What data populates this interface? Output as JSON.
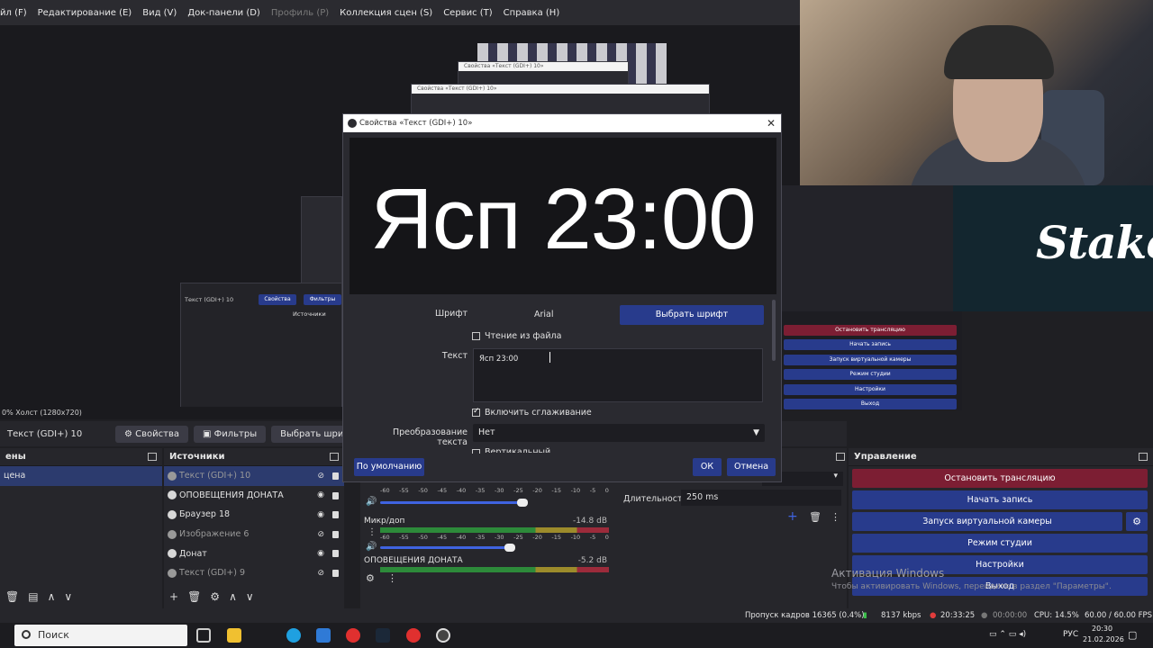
{
  "menu": {
    "items": [
      "йл (F)",
      "Редактирование (E)",
      "Вид (V)",
      "Док-панели (D)",
      "Профиль (P)",
      "Коллекция сцен (S)",
      "Сервис (T)",
      "Справка (H)"
    ]
  },
  "nested": {
    "title_small": "Свойства «Текст (GDI+) 10»",
    "canvas_small": "Холст (1280x720)",
    "source_small": "Текст (GDI+) 10",
    "props_small": "Свойства",
    "filters_small": "Фильтры",
    "sources_small": "Источники"
  },
  "overlay": {
    "stake": "Stake"
  },
  "controls_bg": {
    "stop": "Остановить трансляцию",
    "record": "Начать запись",
    "vcam": "Запуск виртуальной камеры",
    "studio": "Режим студии",
    "settings": "Настройки",
    "exit": "Выход"
  },
  "canvas_bar": "0%   Холст (1280x720)",
  "toolbar": {
    "source_name": "Текст (GDI+) 10",
    "properties": "Свойства",
    "filters": "Фильтры",
    "choose_font": "Выбрать шрифт"
  },
  "scenes": {
    "title": "ены",
    "items": [
      {
        "label": "цена"
      }
    ]
  },
  "sources": {
    "title": "Источники",
    "items": [
      {
        "label": "Текст (GDI+) 10"
      },
      {
        "label": "ОПОВЕЩЕНИЯ ДОНАТА"
      },
      {
        "label": "Браузер 18"
      },
      {
        "label": "Изображение 6"
      },
      {
        "label": "Донат"
      },
      {
        "label": "Текст (GDI+) 9"
      }
    ]
  },
  "mixer": {
    "scale": [
      "-60",
      "-55",
      "-50",
      "-45",
      "-40",
      "-35",
      "-30",
      "-25",
      "-20",
      "-15",
      "-10",
      "-5",
      "0"
    ],
    "channels": [
      {
        "name": "",
        "level": ""
      },
      {
        "name": "Микр/доп",
        "level": "-14.8 dB"
      },
      {
        "name": "ОПОВЕЩЕНИЯ ДОНАТА",
        "level": "-5.2 dB"
      }
    ]
  },
  "transitions": {
    "duration_label": "Длительность",
    "duration_value": "250 ms"
  },
  "control": {
    "title": "Управление",
    "stop": "Остановить трансляцию",
    "record": "Начать запись",
    "vcam": "Запуск виртуальной камеры",
    "studio": "Режим студии",
    "settings": "Настройки",
    "exit": "Выход"
  },
  "activation": {
    "title": "Активация Windows",
    "subtitle": "Чтобы активировать Windows, перейдите в раздел \"Параметры\"."
  },
  "status": {
    "dropped": "Пропуск кадров 16365 (0.4%)",
    "bitrate": "8137 kbps",
    "stream_time": "20:33:25",
    "rec_time": "00:00:00",
    "cpu": "CPU: 14.5%",
    "fps": "60.00 / 60.00 FPS"
  },
  "dialog": {
    "title": "Свойства «Текст (GDI+) 10»",
    "preview_text": "Ясп 23:00",
    "font_label": "Шрифт",
    "font_value": "Arial",
    "choose_font": "Выбрать шрифт",
    "read_from_file": "Чтение из файла",
    "text_label": "Текст",
    "text_value": "Ясп 23:00",
    "antialias": "Включить сглаживание",
    "transform_label": "Преобразование текста",
    "transform_value": "Нет",
    "vertical": "Вертикальный",
    "defaults": "По умолчанию",
    "ok": "ОК",
    "cancel": "Отмена"
  },
  "taskbar": {
    "search": "Поиск",
    "lang": "РУС",
    "time": "20:30",
    "date": "21.02.2026"
  },
  "colors": {
    "accent_blue": "#283b8c",
    "stop_red": "#7c1e33",
    "panel": "#26262b"
  }
}
